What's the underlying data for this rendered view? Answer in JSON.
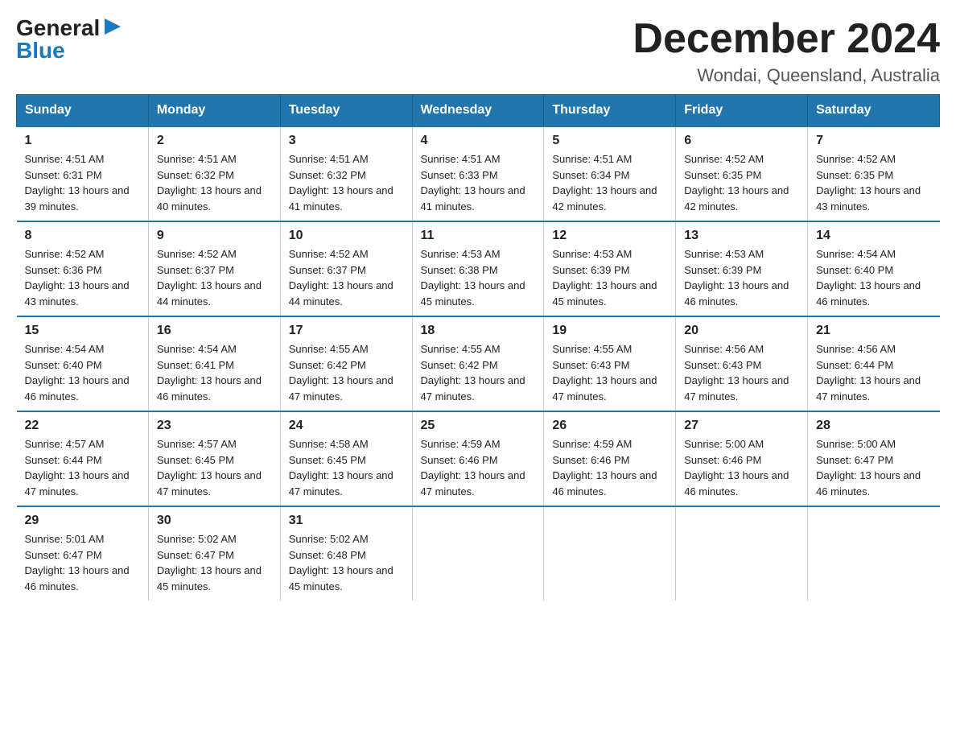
{
  "logo": {
    "general": "General",
    "arrow": "▶",
    "blue": "Blue"
  },
  "header": {
    "title": "December 2024",
    "location": "Wondai, Queensland, Australia"
  },
  "days_of_week": [
    "Sunday",
    "Monday",
    "Tuesday",
    "Wednesday",
    "Thursday",
    "Friday",
    "Saturday"
  ],
  "weeks": [
    [
      {
        "day": "1",
        "sunrise": "4:51 AM",
        "sunset": "6:31 PM",
        "daylight": "13 hours and 39 minutes."
      },
      {
        "day": "2",
        "sunrise": "4:51 AM",
        "sunset": "6:32 PM",
        "daylight": "13 hours and 40 minutes."
      },
      {
        "day": "3",
        "sunrise": "4:51 AM",
        "sunset": "6:32 PM",
        "daylight": "13 hours and 41 minutes."
      },
      {
        "day": "4",
        "sunrise": "4:51 AM",
        "sunset": "6:33 PM",
        "daylight": "13 hours and 41 minutes."
      },
      {
        "day": "5",
        "sunrise": "4:51 AM",
        "sunset": "6:34 PM",
        "daylight": "13 hours and 42 minutes."
      },
      {
        "day": "6",
        "sunrise": "4:52 AM",
        "sunset": "6:35 PM",
        "daylight": "13 hours and 42 minutes."
      },
      {
        "day": "7",
        "sunrise": "4:52 AM",
        "sunset": "6:35 PM",
        "daylight": "13 hours and 43 minutes."
      }
    ],
    [
      {
        "day": "8",
        "sunrise": "4:52 AM",
        "sunset": "6:36 PM",
        "daylight": "13 hours and 43 minutes."
      },
      {
        "day": "9",
        "sunrise": "4:52 AM",
        "sunset": "6:37 PM",
        "daylight": "13 hours and 44 minutes."
      },
      {
        "day": "10",
        "sunrise": "4:52 AM",
        "sunset": "6:37 PM",
        "daylight": "13 hours and 44 minutes."
      },
      {
        "day": "11",
        "sunrise": "4:53 AM",
        "sunset": "6:38 PM",
        "daylight": "13 hours and 45 minutes."
      },
      {
        "day": "12",
        "sunrise": "4:53 AM",
        "sunset": "6:39 PM",
        "daylight": "13 hours and 45 minutes."
      },
      {
        "day": "13",
        "sunrise": "4:53 AM",
        "sunset": "6:39 PM",
        "daylight": "13 hours and 46 minutes."
      },
      {
        "day": "14",
        "sunrise": "4:54 AM",
        "sunset": "6:40 PM",
        "daylight": "13 hours and 46 minutes."
      }
    ],
    [
      {
        "day": "15",
        "sunrise": "4:54 AM",
        "sunset": "6:40 PM",
        "daylight": "13 hours and 46 minutes."
      },
      {
        "day": "16",
        "sunrise": "4:54 AM",
        "sunset": "6:41 PM",
        "daylight": "13 hours and 46 minutes."
      },
      {
        "day": "17",
        "sunrise": "4:55 AM",
        "sunset": "6:42 PM",
        "daylight": "13 hours and 47 minutes."
      },
      {
        "day": "18",
        "sunrise": "4:55 AM",
        "sunset": "6:42 PM",
        "daylight": "13 hours and 47 minutes."
      },
      {
        "day": "19",
        "sunrise": "4:55 AM",
        "sunset": "6:43 PM",
        "daylight": "13 hours and 47 minutes."
      },
      {
        "day": "20",
        "sunrise": "4:56 AM",
        "sunset": "6:43 PM",
        "daylight": "13 hours and 47 minutes."
      },
      {
        "day": "21",
        "sunrise": "4:56 AM",
        "sunset": "6:44 PM",
        "daylight": "13 hours and 47 minutes."
      }
    ],
    [
      {
        "day": "22",
        "sunrise": "4:57 AM",
        "sunset": "6:44 PM",
        "daylight": "13 hours and 47 minutes."
      },
      {
        "day": "23",
        "sunrise": "4:57 AM",
        "sunset": "6:45 PM",
        "daylight": "13 hours and 47 minutes."
      },
      {
        "day": "24",
        "sunrise": "4:58 AM",
        "sunset": "6:45 PM",
        "daylight": "13 hours and 47 minutes."
      },
      {
        "day": "25",
        "sunrise": "4:59 AM",
        "sunset": "6:46 PM",
        "daylight": "13 hours and 47 minutes."
      },
      {
        "day": "26",
        "sunrise": "4:59 AM",
        "sunset": "6:46 PM",
        "daylight": "13 hours and 46 minutes."
      },
      {
        "day": "27",
        "sunrise": "5:00 AM",
        "sunset": "6:46 PM",
        "daylight": "13 hours and 46 minutes."
      },
      {
        "day": "28",
        "sunrise": "5:00 AM",
        "sunset": "6:47 PM",
        "daylight": "13 hours and 46 minutes."
      }
    ],
    [
      {
        "day": "29",
        "sunrise": "5:01 AM",
        "sunset": "6:47 PM",
        "daylight": "13 hours and 46 minutes."
      },
      {
        "day": "30",
        "sunrise": "5:02 AM",
        "sunset": "6:47 PM",
        "daylight": "13 hours and 45 minutes."
      },
      {
        "day": "31",
        "sunrise": "5:02 AM",
        "sunset": "6:48 PM",
        "daylight": "13 hours and 45 minutes."
      },
      null,
      null,
      null,
      null
    ]
  ]
}
